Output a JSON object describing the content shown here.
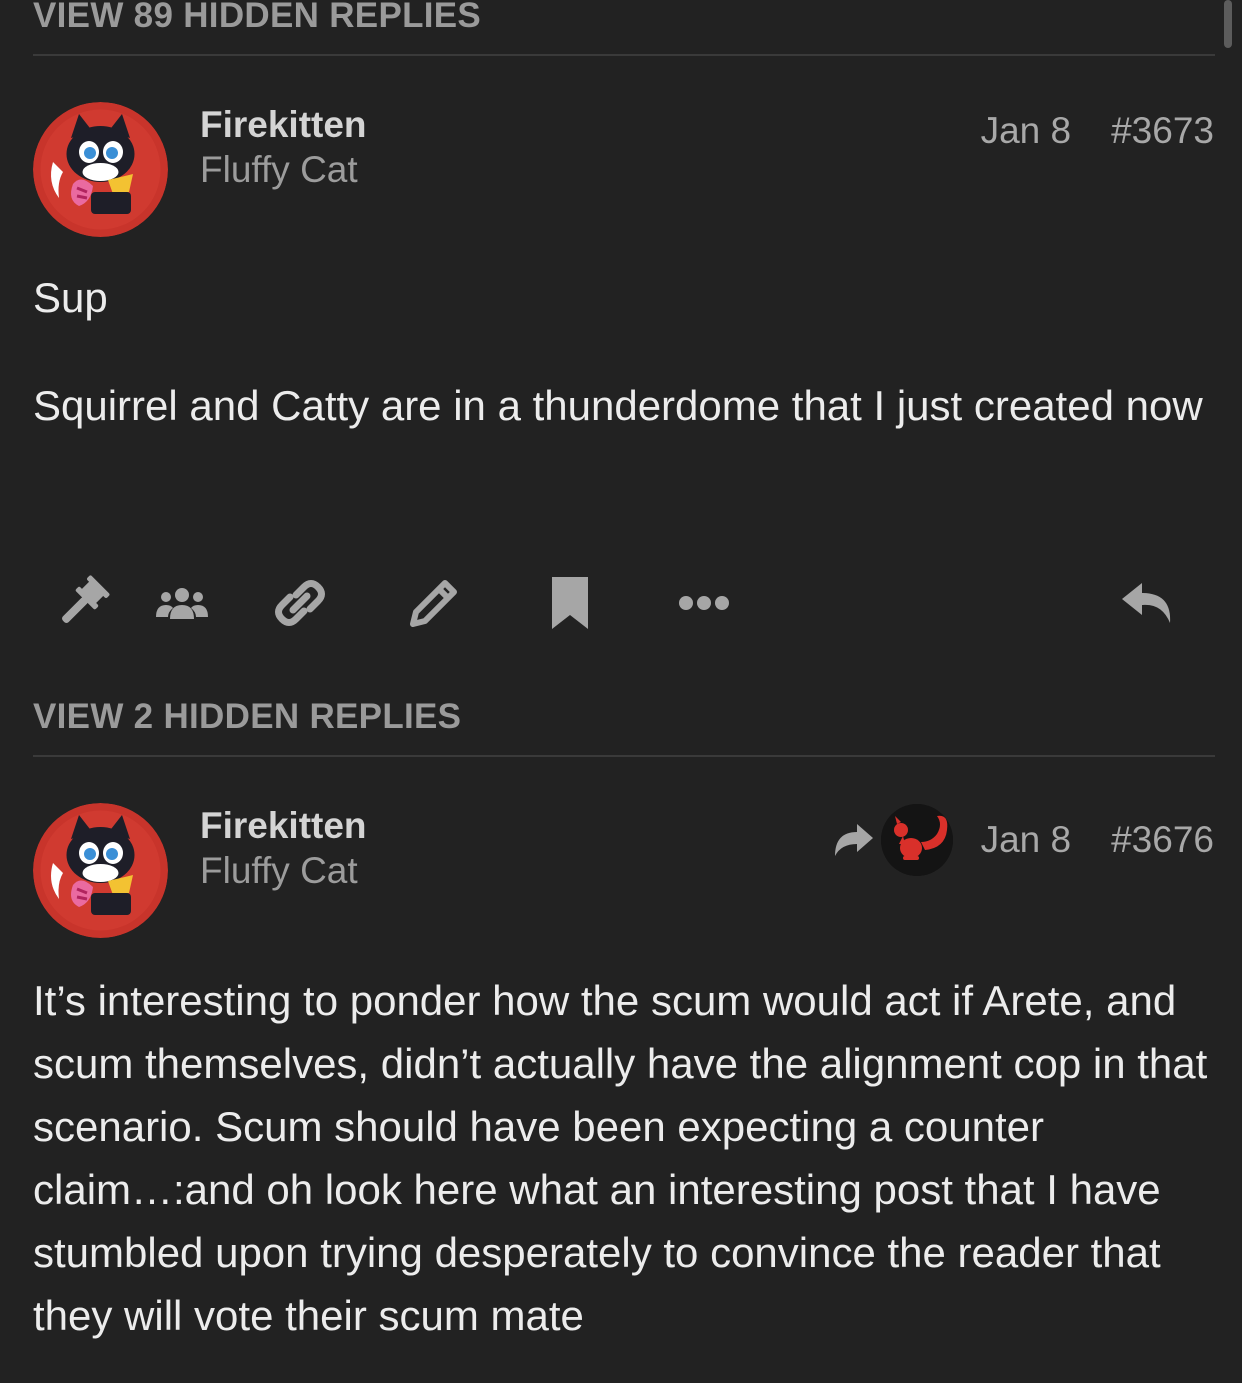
{
  "thread": {
    "hidden_replies_top": "VIEW 89 HIDDEN REPLIES",
    "hidden_replies_middle": "VIEW 2 HIDDEN REPLIES"
  },
  "posts": [
    {
      "username": "Firekitten",
      "user_title": "Fluffy Cat",
      "date": "Jan 8",
      "post_number": "#3673",
      "paragraphs": [
        "Sup",
        "Squirrel and Catty are in a thunderdome that I just created now"
      ],
      "actions": [
        "gavel-icon",
        "group-icon",
        "link-icon",
        "pencil-icon",
        "bookmark-icon",
        "more-icon",
        "reply-icon"
      ]
    },
    {
      "username": "Firekitten",
      "user_title": "Fluffy Cat",
      "date": "Jan 8",
      "post_number": "#3676",
      "reply_to_icon": "share-arrow-icon",
      "paragraphs": [
        "It’s interesting to ponder how the scum would act if Arete, and scum themselves, didn’t actually have the alignment cop in that scenario. Scum should have been expecting a counter claim…:and oh look here what an interesting post that I have stumbled upon trying desperately to convince the reader that they will vote their scum mate"
      ]
    }
  ],
  "colors": {
    "background": "#222222",
    "divider": "#3a3a3a",
    "avatar_ring": "#c8342b",
    "squirrel": "#d9302a",
    "icon": "#a6a6a6"
  }
}
